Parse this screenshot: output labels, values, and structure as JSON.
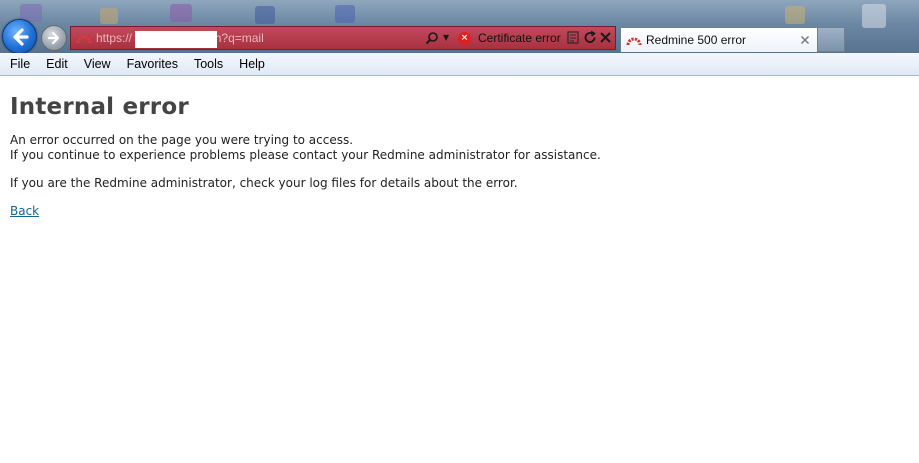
{
  "browser": {
    "address_url": "https://              /redmine/search?q=mail",
    "certificate_error_label": "Certificate error",
    "tab_title": "Redmine 500 error",
    "colors": {
      "address_bar_error": "#b8394a",
      "back_button": "#1f6fd6"
    },
    "icons": {
      "back": "back-arrow-icon",
      "forward": "forward-arrow-icon",
      "favicon": "redmine-logo-icon",
      "search": "search-icon",
      "cert": "certificate-error-icon",
      "compat": "compatibility-view-icon",
      "refresh": "refresh-icon",
      "stop": "stop-icon",
      "close": "close-icon"
    }
  },
  "menu": {
    "items": [
      "File",
      "Edit",
      "View",
      "Favorites",
      "Tools",
      "Help"
    ]
  },
  "page": {
    "title": "Internal error",
    "message_line_1": "An error occurred on the page you were trying to access.",
    "message_line_2": "If you continue to experience problems please contact your Redmine administrator for assistance.",
    "admin_message": "If you are the Redmine administrator, check your log files for details about the error.",
    "back_link": "Back",
    "link_color": "#116699"
  }
}
